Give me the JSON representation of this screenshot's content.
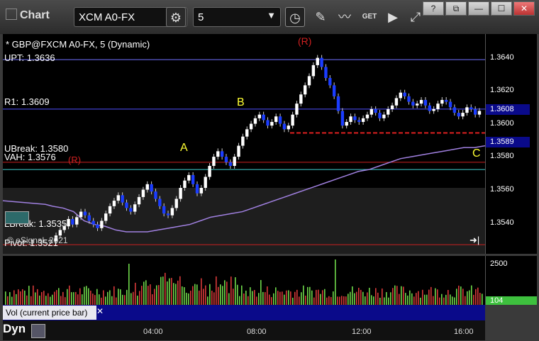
{
  "app": {
    "title": "Chart"
  },
  "toolbar": {
    "symbol": "XCM A0-FX",
    "interval": "5",
    "get_label": "GET"
  },
  "window_buttons": {
    "help": "?",
    "restore": "⧉",
    "minimize": "—",
    "maximize": "☐",
    "close": "✕"
  },
  "chart": {
    "symbol_header": "* GBP@FXCM A0-FX, 5 (Dynamic)",
    "levels": {
      "upt": "UPT: 1.3636",
      "r1": "R1: 1.3609",
      "ubreak": "UBreak: 1.3580",
      "vah": "VAH: 1.3576",
      "lbreak": "LBreak: 1.3535",
      "pivot": "Pivot: 1.3521"
    },
    "markers": {
      "r_top": "(R)",
      "r_left": "(R)",
      "a": "A",
      "b": "B",
      "c": "C"
    },
    "copyright": "© eSignal, 2021",
    "price_ticks": [
      "1.3640",
      "1.3620",
      "1.3600",
      "1.3580",
      "1.3560",
      "1.3540"
    ],
    "last_price": "1.3608",
    "vwap_price": "1.3589",
    "colors": {
      "up_bar": "#ffffff",
      "down_bar": "#1a3cff",
      "vwap": "#a080e0",
      "level_line": "#cc2222",
      "price_box": "#0a0a8a"
    }
  },
  "volume": {
    "label": "Vol (current price bar)",
    "tick": "2500",
    "last": "104",
    "colors": {
      "up": "#6fd84a",
      "down": "#d83a3a",
      "last_box": "#3ec03e"
    }
  },
  "time_axis": {
    "ticks": [
      "04:00",
      "08:00",
      "12:00",
      "16:00"
    ]
  },
  "footer": {
    "brand": "Dyn"
  },
  "chart_data": {
    "type": "candlestick",
    "instrument": "GBP@FXCM A0-FX",
    "interval": "5",
    "ylim": [
      1.353,
      1.365
    ],
    "x_ticks": [
      "04:00",
      "08:00",
      "12:00",
      "16:00"
    ],
    "levels": [
      {
        "name": "UPT",
        "value": 1.3636
      },
      {
        "name": "R1",
        "value": 1.3609
      },
      {
        "name": "UBreak",
        "value": 1.358
      },
      {
        "name": "VAH",
        "value": 1.3576
      },
      {
        "name": "LBreak",
        "value": 1.3535
      },
      {
        "name": "Pivot",
        "value": 1.3521
      }
    ],
    "close_series": [
      1.354,
      1.3543,
      1.3545,
      1.3549,
      1.3546,
      1.355,
      1.3553,
      1.3551,
      1.3548,
      1.3546,
      1.3544,
      1.3548,
      1.3552,
      1.3556,
      1.3559,
      1.3562,
      1.3558,
      1.3555,
      1.3553,
      1.3557,
      1.3561,
      1.3565,
      1.3568,
      1.3564,
      1.356,
      1.3556,
      1.3552,
      1.3551,
      1.3555,
      1.356,
      1.3566,
      1.357,
      1.3573,
      1.3568,
      1.3563,
      1.3566,
      1.3572,
      1.3578,
      1.3583,
      1.3586,
      1.3583,
      1.358,
      1.3578,
      1.3583,
      1.3589,
      1.3594,
      1.3598,
      1.3601,
      1.3604,
      1.3606,
      1.3603,
      1.36,
      1.3602,
      1.3605,
      1.3601,
      1.3598,
      1.36,
      1.3606,
      1.3612,
      1.3617,
      1.3622,
      1.3627,
      1.3633,
      1.3637,
      1.3632,
      1.3626,
      1.3622,
      1.3616,
      1.3608,
      1.36,
      1.3602,
      1.3605,
      1.3603,
      1.3602,
      1.3604,
      1.3606,
      1.3609,
      1.3607,
      1.3604,
      1.3606,
      1.3609,
      1.3611,
      1.3615,
      1.3618,
      1.3616,
      1.3613,
      1.3611,
      1.3612,
      1.3614,
      1.3611,
      1.3608,
      1.3609,
      1.3612,
      1.3614,
      1.3613,
      1.361,
      1.3607,
      1.3605,
      1.3607,
      1.361,
      1.3609,
      1.3606,
      1.3608
    ],
    "vwap_series": [
      1.3556,
      1.3555,
      1.3553,
      1.3548,
      1.3546,
      1.3545,
      1.3543,
      1.3542,
      1.3542,
      1.3542,
      1.3543,
      1.3544,
      1.3545,
      1.3546,
      1.3548,
      1.355,
      1.3551,
      1.3552,
      1.3553,
      1.3555,
      1.3557,
      1.3559,
      1.3561,
      1.3563,
      1.3565,
      1.3567,
      1.3569,
      1.3571,
      1.3573,
      1.3575,
      1.3576,
      1.3578,
      1.358,
      1.3582,
      1.3583,
      1.3584,
      1.3585,
      1.3586,
      1.3587,
      1.3588,
      1.3588,
      1.3589
    ],
    "volume_max": 2500,
    "volume_last": 104
  }
}
